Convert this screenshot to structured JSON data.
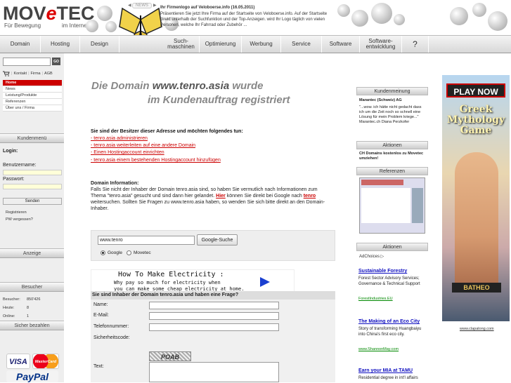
{
  "logo": {
    "text_a": "MOV",
    "text_e": "e",
    "text_b": "TEC",
    "sub_left": "Für Bewegung",
    "sub_right": "im Internet"
  },
  "news": {
    "label": "NEWS",
    "title": "Ihr Firmenlogo auf Veloboerse.info (16.05.2011)",
    "text": "Präsentieren Sie jetzt Ihre Firma auf der Startseite von Veloboerse.info. Auf der Startseite direkt unterhalb der Suchfunktion und der Top-Anzeigen. wird Ihr Logo täglich von vielen Personen, welche Ihr Fahrrad oder Zubehör ..."
  },
  "nav": [
    {
      "label": "Domain"
    },
    {
      "label": "Hosting"
    },
    {
      "label": "Design"
    },
    {
      "label": "Such-\nmaschinen"
    },
    {
      "label": "Optimierung"
    },
    {
      "label": "Werbung"
    },
    {
      "label": "Service"
    },
    {
      "label": "Software"
    },
    {
      "label": "Software-\nentwicklung"
    },
    {
      "label": "?"
    }
  ],
  "left": {
    "go_label": "GO",
    "cart": {
      "kontakt": "Kontakt",
      "firma": "Firma",
      "agb": "AGB"
    },
    "menu": [
      {
        "label": "Home",
        "active": true
      },
      {
        "label": "News"
      },
      {
        "label": "Leistung/Produkte"
      },
      {
        "label": "Referenzen"
      },
      {
        "label": "Über uns / Firma"
      }
    ],
    "kundenmenu": "Kundenmenü",
    "login": "Login:",
    "username_label": "Benutzername:",
    "password_label": "Passwort:",
    "send": "Senden",
    "register": "Registrieren",
    "forgot": "PW vergessen?",
    "anzeige": "Anzeige",
    "besucher": "Besucher",
    "stats": {
      "besucher_label": "Besucher:",
      "besucher_value": "850'426",
      "heute_label": "Heute:",
      "heute_value": "8",
      "online_label": "Online:",
      "online_value": "1"
    },
    "pay_head": "Sicher bezahlen",
    "pay": {
      "visa": "VISA",
      "mastercard": "MasterCard",
      "paypal": "PayPal"
    }
  },
  "main": {
    "headline_pre": "Die Domain ",
    "headline_domain": "www.tenro.asia",
    "headline_post": " wurde",
    "headline2": "im Kundenauftrag registriert",
    "owner_q": "Sie sind der Besitzer dieser Adresse und möchten folgendes tun:",
    "links": [
      "- tenro.asia administrieren",
      "- tenro.asia weiterleiten auf eine andere Domain",
      "- Einen Hostingaccount einrichten",
      "- tenro.asia einem bestehenden Hostingaccount hinzufügen"
    ],
    "info_title": "Domain Information:",
    "info_1": "Falls Sie nicht der Inhaber der Domain tenro.asia sind, so haben Sie vermutlich nach Informationen zum Thema \"tenro.asia\" gesucht und sind dann hier gelandet. ",
    "info_hier": "Hier",
    "info_2": " können Sie direkt bei Google nach ",
    "info_tenro": "tenro",
    "info_3": " weitersuchen. Sollten Sie Fragen zu www.tenro.asia haben, so wenden Sie sich bitte direkt an den Domain-Inhaber.",
    "search_value": "www.tenro",
    "search_button": "Google-Suche",
    "radio_google": "Google",
    "radio_movetec": "Movetec",
    "ad": {
      "title": "How To Make Electricity :",
      "line1": "Why pay so much for electricity when",
      "line2": "you can make some cheap electricity at home."
    },
    "form_head": "Sie sind Inhaber der Domain tenro.asia und haben eine Frage?",
    "form": {
      "name": "Name:",
      "email": "E-Mail:",
      "phone": "Telefonnummer:",
      "code": "Sicherheitscode:",
      "text": "Text:",
      "captcha": "POAB"
    }
  },
  "right": {
    "kundenmeinung": "Kundenmeinung",
    "quote_company": "Marantec (Schweiz) AG",
    "quote": "\"...wow. ich hätte nicht gedacht dass ich um die Zeit noch so schnell eine Lösung für mein Problem kriege...\" Marantec.ch Diana Perzkofer",
    "aktionen": "Aktionen",
    "aktion_text": "CH Domains kostenlos zu Movetec umziehen!",
    "referenzen": "Referenzen",
    "aktionen2": "Aktionen",
    "adchoices": "AdChoices ▷",
    "ads": [
      {
        "title": "Sustainable Forestry",
        "text": "Forest Sector Advisory Services; Governance & Technical Support",
        "url": "ForestIndustries.EU"
      },
      {
        "title": "The Making of an Eco City",
        "text": "Story of transforming Huangbaiyu into China's first eco city.",
        "url": "www.ShannonMay.com"
      },
      {
        "title": "Earn your MIA at TAMU",
        "text": "Residential degree in int'l affairs",
        "url": ""
      }
    ]
  },
  "banner": {
    "play": "PLAY NOW",
    "title": "Greek Mythology Game",
    "brand": "BATHEO",
    "url": "www.clapalong.com"
  },
  "colors": {
    "accent": "#cc0000",
    "link": "#1010c0"
  }
}
